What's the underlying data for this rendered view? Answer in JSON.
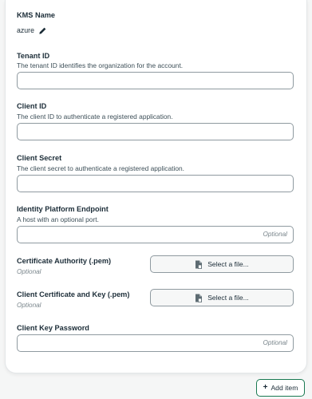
{
  "kms": {
    "label": "KMS Name",
    "value": "azure"
  },
  "tenant_id": {
    "label": "Tenant ID",
    "description": "The tenant ID identifies the organization for the account.",
    "value": ""
  },
  "client_id": {
    "label": "Client ID",
    "description": "The client ID to authenticate a registered application.",
    "value": ""
  },
  "client_secret": {
    "label": "Client Secret",
    "description": "The client secret to authenticate a registered application.",
    "value": ""
  },
  "endpoint": {
    "label": "Identity Platform Endpoint",
    "description": "A host with an optional port.",
    "placeholder": "Optional"
  },
  "ca": {
    "label": "Certificate Authority (.pem)",
    "optional": "Optional",
    "button": "Select a file..."
  },
  "client_cert": {
    "label": "Client Certificate and Key (.pem)",
    "optional": "Optional",
    "button": "Select a file..."
  },
  "client_key_password": {
    "label": "Client Key Password",
    "placeholder": "Optional"
  },
  "add_item": {
    "label": "Add item"
  },
  "colors": {
    "accent_green": "#1a7a52",
    "border": "#8f9aa0"
  },
  "icons": [
    "pencil-icon",
    "file-icon",
    "plus-icon"
  ]
}
